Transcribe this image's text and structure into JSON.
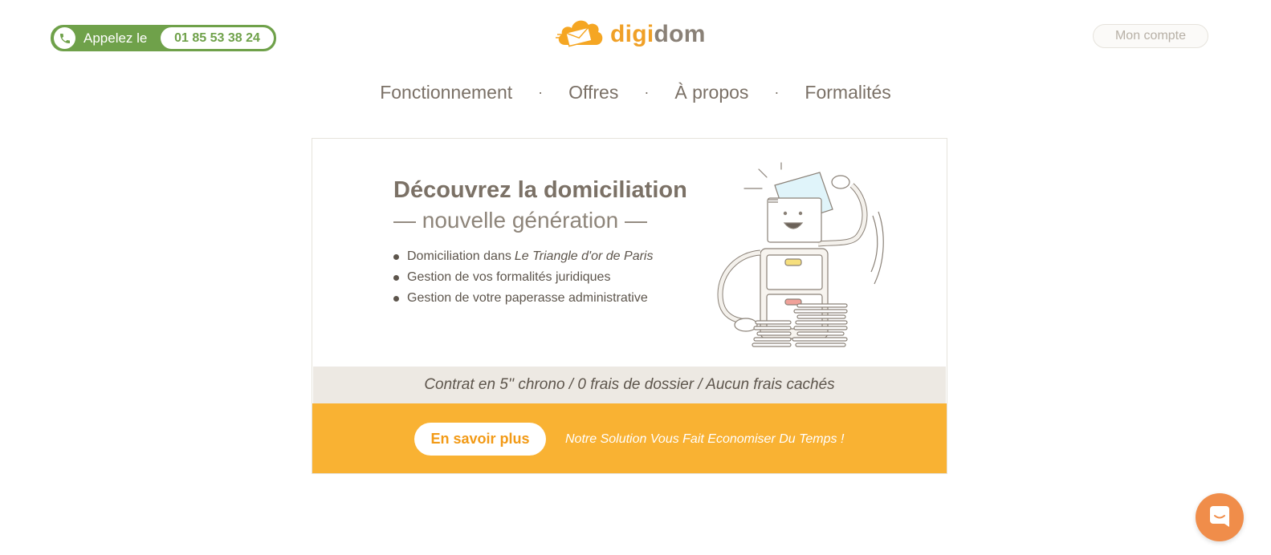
{
  "header": {
    "call_label": "Appelez le",
    "phone_number": "01 85 53 38 24",
    "logo_part1": "digi",
    "logo_part2": "dom",
    "account_label": "Mon compte"
  },
  "nav": {
    "items": [
      {
        "label": "Fonctionnement"
      },
      {
        "label": "Offres"
      },
      {
        "label": "À propos"
      },
      {
        "label": "Formalités"
      }
    ],
    "separator": "·"
  },
  "hero": {
    "title": "Découvrez la domiciliation",
    "subtitle": "— nouvelle génération —",
    "features": [
      {
        "text": "Domiciliation dans",
        "emphasis": "Le Triangle d'or de Paris"
      },
      {
        "text": "Gestion de vos formalités juridiques"
      },
      {
        "text": "Gestion de votre paperasse administrative"
      }
    ]
  },
  "tagline": "Contrat en 5'' chrono / 0 frais de dossier / Aucun frais cachés",
  "cta": {
    "button_label": "En savoir plus",
    "text": "Notre Solution Vous Fait Economiser Du Temps !"
  },
  "colors": {
    "green": "#6fa14a",
    "orange": "#f9b233",
    "logo_orange": "#f0a026",
    "chat": "#f08d4a"
  },
  "icons": {
    "phone": "phone-icon",
    "logo": "cloud-envelope-logo-icon",
    "chat": "chat-bubble-icon",
    "illustration": "filing-cabinet-robot-illustration"
  }
}
